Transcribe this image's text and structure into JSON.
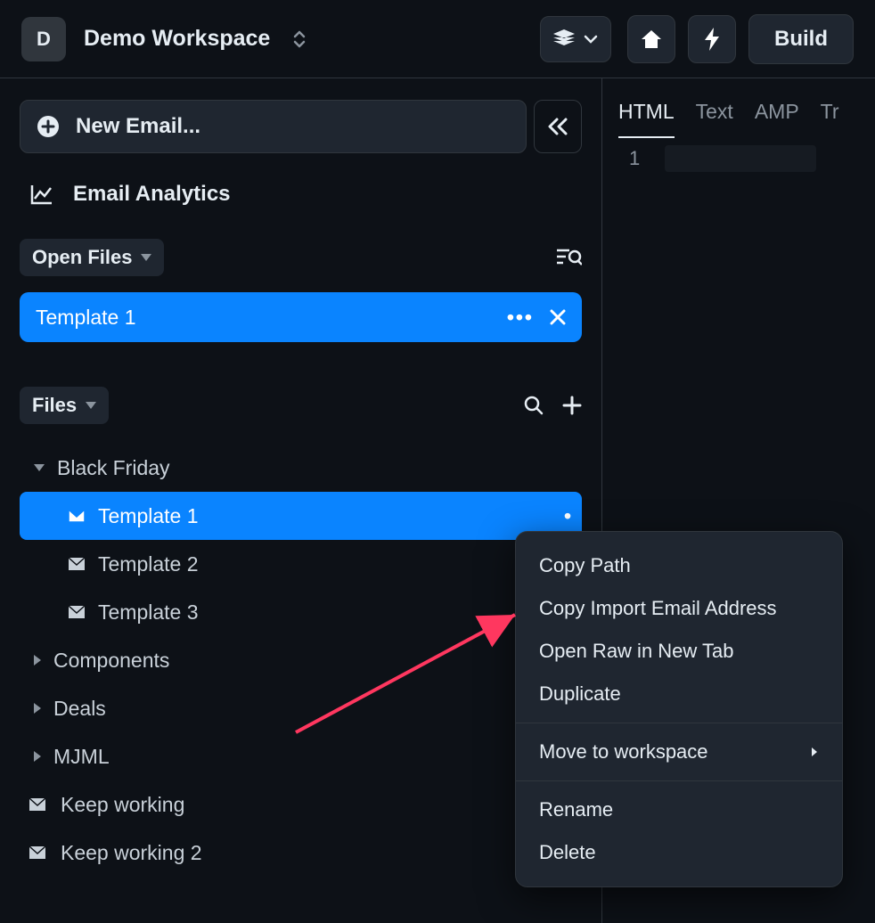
{
  "workspace": {
    "badge": "D",
    "name": "Demo Workspace"
  },
  "topbar": {
    "build_label": "Build"
  },
  "sidebar": {
    "new_email_label": "New Email...",
    "analytics_label": "Email Analytics",
    "open_files_label": "Open Files",
    "open_file": {
      "name": "Template 1"
    },
    "files_label": "Files"
  },
  "tree": {
    "black_friday": "Black Friday",
    "template1": "Template 1",
    "template2": "Template 2",
    "template3": "Template 3",
    "components": "Components",
    "deals": "Deals",
    "mjml": "MJML",
    "keep_working": "Keep working",
    "keep_working_2": "Keep working 2"
  },
  "tabs": {
    "html": "HTML",
    "text": "Text",
    "amp": "AMP",
    "tr": "Tr"
  },
  "editor": {
    "line1": "1"
  },
  "context_menu": {
    "copy_path": "Copy Path",
    "copy_import": "Copy Import Email Address",
    "open_raw": "Open Raw in New Tab",
    "duplicate": "Duplicate",
    "move_to_ws": "Move to workspace",
    "rename": "Rename",
    "delete": "Delete"
  }
}
